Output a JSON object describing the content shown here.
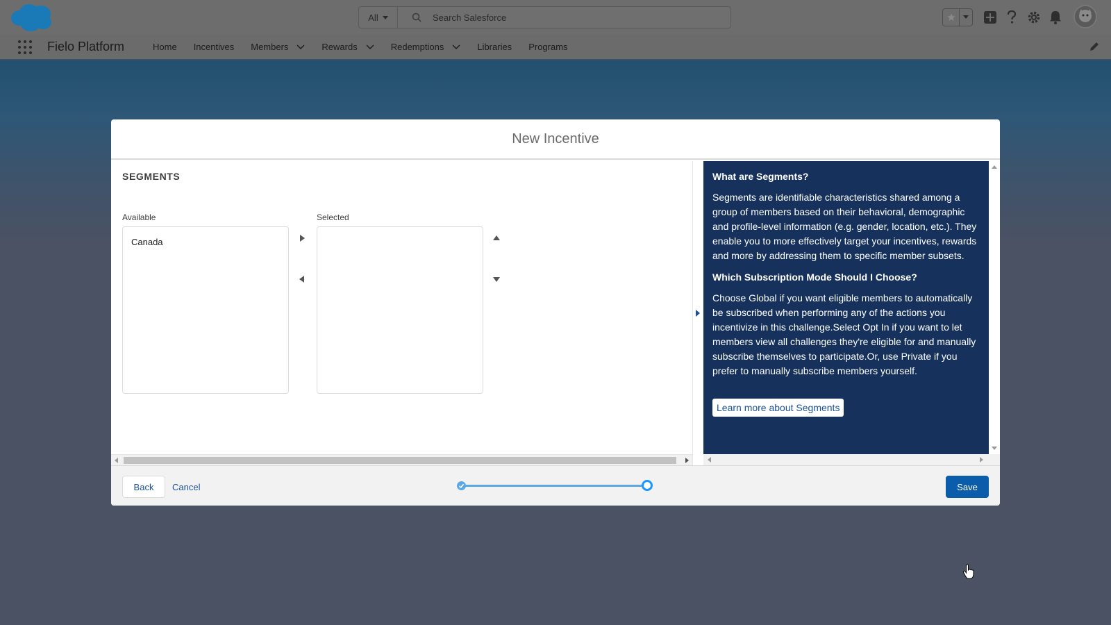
{
  "header": {
    "search_scope": "All",
    "search_placeholder": "Search Salesforce"
  },
  "app_nav": {
    "app_name": "Fielo Platform",
    "items": [
      {
        "label": "Home",
        "has_menu": false
      },
      {
        "label": "Incentives",
        "has_menu": false
      },
      {
        "label": "Members",
        "has_menu": true
      },
      {
        "label": "Rewards",
        "has_menu": true
      },
      {
        "label": "Redemptions",
        "has_menu": true
      },
      {
        "label": "Libraries",
        "has_menu": false
      },
      {
        "label": "Programs",
        "has_menu": false
      }
    ]
  },
  "modal": {
    "title": "New Incentive",
    "section_title": "SEGMENTS",
    "available_label": "Available",
    "selected_label": "Selected",
    "available_options": [
      "Canada"
    ],
    "selected_options": []
  },
  "help": {
    "heading1": "What are Segments?",
    "body1": "Segments are identifiable characteristics shared among a group of members based on their behavioral, demographic and profile-level information (e.g. gender, location, etc.). They enable you to more effectively target your incentives, rewards and more by addressing them to specific member subsets.",
    "heading2": "Which Subscription Mode Should I Choose?",
    "body2": "Choose Global if you want eligible members to automatically be subscribed when performing any of the actions you incentivize in this challenge.Select Opt In if you want to let members view all challenges they're eligible for and manually subscribe themselves to participate.Or, use Private if you prefer to manually subscribe members yourself.",
    "learn_more": "Learn more about Segments"
  },
  "footer": {
    "back_label": "Back",
    "cancel_label": "Cancel",
    "save_label": "Save",
    "progress_steps_total": 2,
    "progress_current_step": 2
  },
  "colors": {
    "brand_blue": "#0b5cab",
    "help_bg": "#16325c",
    "progress": "#5aa9e6"
  }
}
